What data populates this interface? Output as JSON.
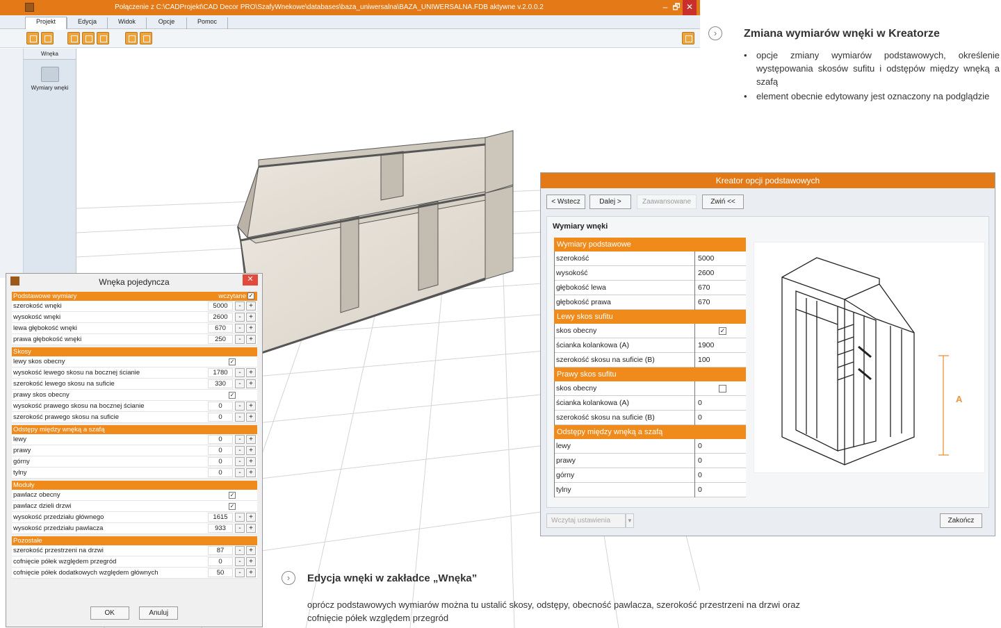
{
  "window": {
    "title": "Połączenie z C:\\CADProjekt\\CAD Decor PRO\\SzafyWnekowe\\databases\\baza_uniwersalna\\BAZA_UNIWERSALNA.FDB aktywne  v.2.0.0.2",
    "min_symbol": "–",
    "max_symbol": "🗗",
    "close_symbol": "✕"
  },
  "menu": [
    "Projekt",
    "Edycja",
    "Widok",
    "Opcje",
    "Pomoc"
  ],
  "sidebar": {
    "header": "Wnęka",
    "item_label": "Wymiary wnęki"
  },
  "dialog_single": {
    "title": "Wnęka pojedyncza",
    "close_symbol": "✕",
    "sections": [
      {
        "title": "Podstawowe wymiary",
        "extra": "wczytane",
        "checked": true,
        "rows": [
          {
            "label": "szerokość wnęki",
            "value": "5000"
          },
          {
            "label": "wysokość wnęki",
            "value": "2600"
          },
          {
            "label": "lewa głębokość wnęki",
            "value": "670"
          },
          {
            "label": "prawa głębokość wnęki",
            "value": "250"
          }
        ]
      },
      {
        "title": "Skosy",
        "rows": [
          {
            "label": "lewy skos obecny",
            "check": "✓"
          },
          {
            "label": "wysokość lewego skosu na bocznej ścianie",
            "value": "1780"
          },
          {
            "label": "szerokość lewego skosu na suficie",
            "value": "330"
          },
          {
            "label": "prawy skos obecny",
            "check": "✓"
          },
          {
            "label": "wysokość prawego skosu na bocznej ścianie",
            "value": "0"
          },
          {
            "label": "szerokość prawego skosu na suficie",
            "value": "0"
          }
        ]
      },
      {
        "title": "Odstępy między wnęką a szafą",
        "rows": [
          {
            "label": "lewy",
            "value": "0"
          },
          {
            "label": "prawy",
            "value": "0"
          },
          {
            "label": "górny",
            "value": "0"
          },
          {
            "label": "tylny",
            "value": "0"
          }
        ]
      },
      {
        "title": "Moduły",
        "rows": [
          {
            "label": "pawlacz obecny",
            "check": "✓"
          },
          {
            "label": "pawlacz dzieli drzwi",
            "check": "✓"
          },
          {
            "label": "wysokość przedziału głównego",
            "value": "1615"
          },
          {
            "label": "wysokość przedziału pawlacza",
            "value": "933"
          }
        ]
      },
      {
        "title": "Pozostałe",
        "rows": [
          {
            "label": "szerokość przestrzeni na drzwi",
            "value": "87"
          },
          {
            "label": "cofnięcie półek względem przegród",
            "value": "0"
          },
          {
            "label": "cofnięcie półek dodatkowych względem głównych",
            "value": "50"
          }
        ]
      }
    ],
    "minus": "-",
    "plus": "+",
    "ok": "OK",
    "cancel": "Anuluj"
  },
  "dialog_wizard": {
    "title": "Kreator opcji podstawowych",
    "back": "< Wstecz",
    "next": "Dalej >",
    "advanced": "Zaawansowane",
    "collapse": "Zwiń <<",
    "heading": "Wymiary wnęki",
    "sections": [
      {
        "title": "Wymiary podstawowe",
        "rows": [
          {
            "label": "szerokość",
            "value": "5000"
          },
          {
            "label": "wysokość",
            "value": "2600"
          },
          {
            "label": "głębokość lewa",
            "value": "670"
          },
          {
            "label": "głębokość prawa",
            "value": "670"
          }
        ]
      },
      {
        "title": "Lewy skos sufitu",
        "rows": [
          {
            "label": "skos obecny",
            "check": "✓"
          },
          {
            "label": "ścianka kolankowa (A)",
            "value": "1900"
          },
          {
            "label": "szerokość skosu na suficie (B)",
            "value": "100"
          }
        ]
      },
      {
        "title": "Prawy skos sufitu",
        "rows": [
          {
            "label": "skos obecny",
            "check": ""
          },
          {
            "label": "ścianka kolankowa (A)",
            "value": "0"
          },
          {
            "label": "szerokość skosu na suficie (B)",
            "value": "0"
          }
        ]
      },
      {
        "title": "Odstępy między wnęką a szafą",
        "rows": [
          {
            "label": "lewy",
            "value": "0"
          },
          {
            "label": "prawy",
            "value": "0"
          },
          {
            "label": "górny",
            "value": "0"
          },
          {
            "label": "tylny",
            "value": "0"
          }
        ]
      }
    ],
    "preview_label": "A",
    "load_settings": "Wczytaj ustawienia",
    "dropdown_arrow": "▼",
    "finish": "Zakończ"
  },
  "annotation_top": {
    "icon": "›",
    "title": "Zmiana wymiarów wnęki w Kreatorze",
    "bullets": [
      "opcje zmiany wymiarów podstawowych, określenie występowania skosów sufitu i odstępów między wnęką a szafą",
      "element obecnie edytowany jest oznaczony na podglądzie"
    ]
  },
  "annotation_bottom": {
    "icon": "›",
    "title": "Edycja wnęki w zakładce „Wnęka”",
    "text": "oprócz podstawowych wymiarów można tu ustalić skosy, odstępy, obecność pawlacza, szerokość przestrzeni na drzwi oraz cofnięcie półek względem przegród"
  },
  "colors": {
    "accent": "#e47a17",
    "section": "#ef8a1b"
  }
}
